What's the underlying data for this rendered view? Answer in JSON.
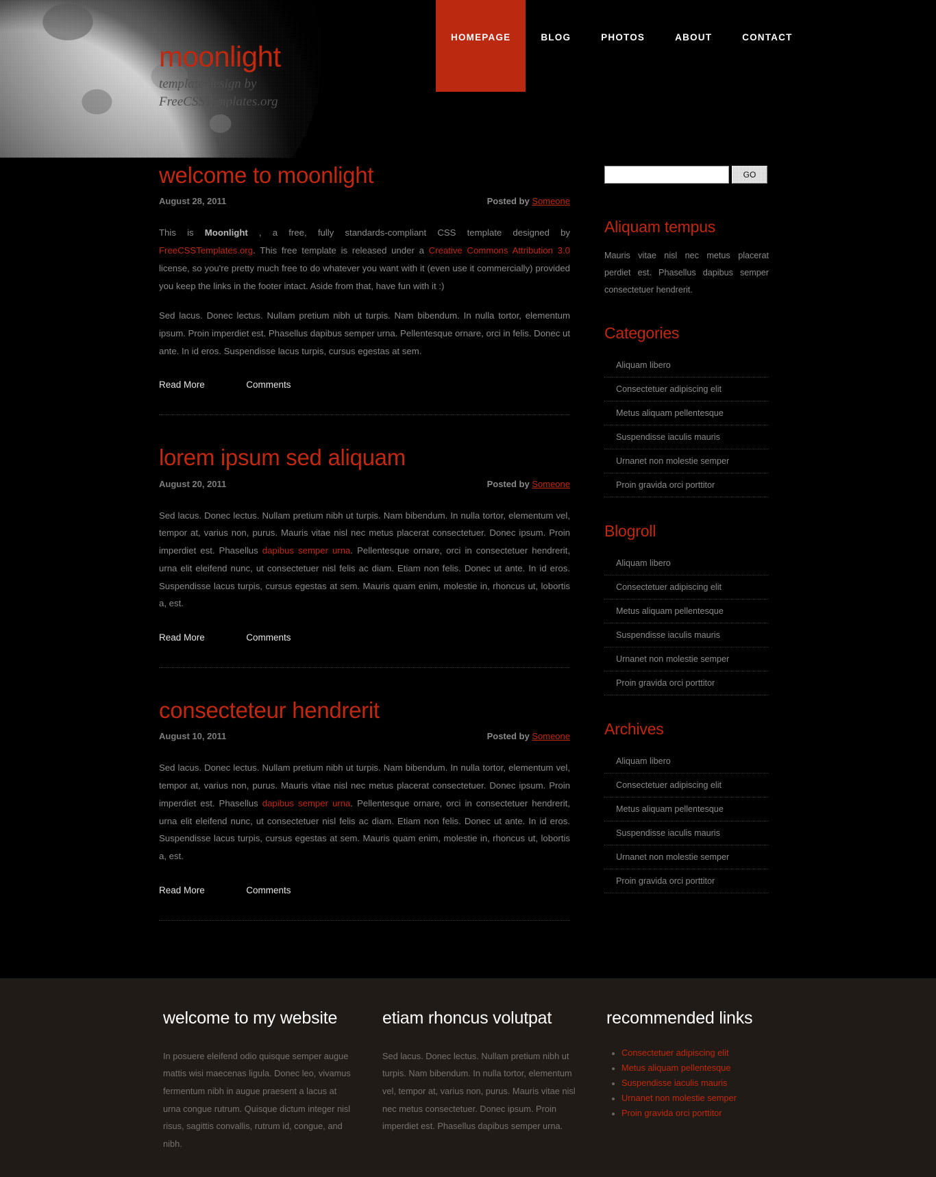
{
  "site": {
    "title": "moonlight",
    "tagline": "template design by FreeCSSTemplates.org",
    "accent_color": "#bb2a10",
    "background_color": "#000000",
    "footer_background_color": "#201b16"
  },
  "menu": {
    "items": [
      {
        "label": "HOMEPAGE",
        "active": true
      },
      {
        "label": "BLOG",
        "active": false
      },
      {
        "label": "PHOTOS",
        "active": false
      },
      {
        "label": "ABOUT",
        "active": false
      },
      {
        "label": "CONTACT",
        "active": false
      }
    ]
  },
  "posts": [
    {
      "title": "welcome to moonlight",
      "date": "August 28, 2011",
      "posted_by_label": "Posted by",
      "author": "Someone",
      "body_1_part1": "This is ",
      "body_1_strong": "Moonlight",
      "body_1_part2": " , a free, fully standards-compliant CSS template designed by ",
      "body_1_link1": "FreeCSSTemplates.org",
      "body_1_part3": ". This free template is released under a ",
      "body_1_link2": "Creative Commons Attribution 3.0",
      "body_1_part4": " license, so you're pretty much free to do whatever you want with it (even use it commercially) provided you keep the links in the footer intact. Aside from that, have fun with it :)",
      "body_2": "Sed lacus. Donec lectus. Nullam pretium nibh ut turpis. Nam bibendum. In nulla tortor, elementum ipsum. Proin imperdiet est. Phasellus dapibus semper urna. Pellentesque ornare, orci in felis. Donec ut ante. In id eros. Suspendisse lacus turpis, cursus egestas at sem.",
      "read_more": "Read More",
      "comments": "Comments"
    },
    {
      "title": "lorem ipsum sed aliquam",
      "date": "August 20, 2011",
      "posted_by_label": "Posted by",
      "author": "Someone",
      "body_part1": "Sed lacus. Donec lectus. Nullam pretium nibh ut turpis. Nam bibendum. In nulla tortor, elementum vel, tempor at, varius non, purus. Mauris vitae nisl nec metus placerat consectetuer. Donec ipsum. Proin imperdiet est. Phasellus ",
      "body_link": "dapibus semper urna",
      "body_part2": ". Pellentesque ornare, orci in consectetuer hendrerit, urna elit eleifend nunc, ut consectetuer nisl felis ac diam. Etiam non felis. Donec ut ante. In id eros. Suspendisse lacus turpis, cursus egestas at sem. Mauris quam enim, molestie in, rhoncus ut, lobortis a, est.",
      "read_more": "Read More",
      "comments": "Comments"
    },
    {
      "title": "consecteteur hendrerit",
      "date": "August 10, 2011",
      "posted_by_label": "Posted by",
      "author": "Someone",
      "body_part1": "Sed lacus. Donec lectus. Nullam pretium nibh ut turpis. Nam bibendum. In nulla tortor, elementum vel, tempor at, varius non, purus. Mauris vitae nisl nec metus placerat consectetuer. Donec ipsum. Proin imperdiet est. Phasellus ",
      "body_link": "dapibus semper urna",
      "body_part2": ". Pellentesque ornare, orci in consectetuer hendrerit, urna elit eleifend nunc, ut consectetuer nisl felis ac diam. Etiam non felis. Donec ut ante. In id eros. Suspendisse lacus turpis, cursus egestas at sem. Mauris quam enim, molestie in, rhoncus ut, lobortis a, est.",
      "read_more": "Read More",
      "comments": "Comments"
    }
  ],
  "sidebar": {
    "search": {
      "value": "",
      "placeholder": "",
      "button_label": "GO"
    },
    "aliquam": {
      "heading": "Aliquam tempus",
      "text": "Mauris vitae nisl nec metus placerat perdiet est. Phasellus dapibus semper consectetuer hendrerit."
    },
    "categories": {
      "heading": "Categories",
      "items": [
        "Aliquam libero",
        "Consectetuer adipiscing elit",
        "Metus aliquam pellentesque",
        "Suspendisse iaculis mauris",
        "Urnanet non molestie semper",
        "Proin gravida orci porttitor"
      ]
    },
    "blogroll": {
      "heading": "Blogroll",
      "items": [
        "Aliquam libero",
        "Consectetuer adipiscing elit",
        "Metus aliquam pellentesque",
        "Suspendisse iaculis mauris",
        "Urnanet non molestie semper",
        "Proin gravida orci porttitor"
      ]
    },
    "archives": {
      "heading": "Archives",
      "items": [
        "Aliquam libero",
        "Consectetuer adipiscing elit",
        "Metus aliquam pellentesque",
        "Suspendisse iaculis mauris",
        "Urnanet non molestie semper",
        "Proin gravida orci porttitor"
      ]
    }
  },
  "footer": {
    "col1": {
      "heading": "welcome to my website",
      "text": "In posuere eleifend odio quisque semper augue mattis wisi maecenas ligula. Donec leo, vivamus fermentum nibh in augue praesent a lacus at urna congue rutrum. Quisque dictum integer nisl risus, sagittis convallis, rutrum id, congue, and nibh."
    },
    "col2": {
      "heading": "etiam rhoncus volutpat",
      "text": "Sed lacus. Donec lectus. Nullam pretium nibh ut turpis. Nam bibendum. In nulla tortor, elementum vel, tempor at, varius non, purus. Mauris vitae nisl nec metus consectetuer. Donec ipsum. Proin imperdiet est. Phasellus dapibus semper urna."
    },
    "col3": {
      "heading": "recommended links",
      "items": [
        "Consectetuer adipiscing elit",
        "Metus aliquam pellentesque",
        "Suspendisse iaculis mauris",
        "Urnanet non molestie semper",
        "Proin gravida orci porttitor"
      ]
    }
  }
}
